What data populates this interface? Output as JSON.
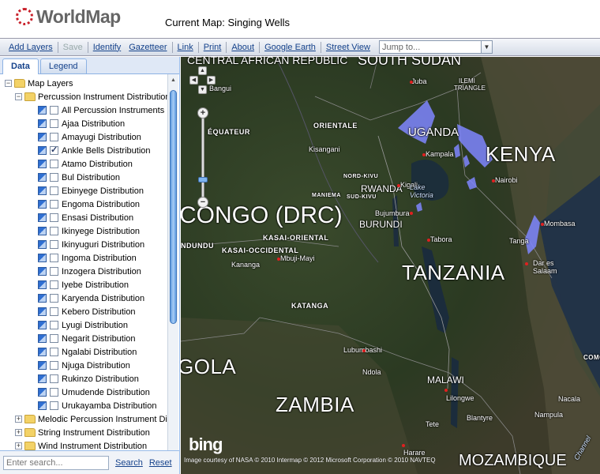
{
  "header": {
    "logo_text": "WorldMap",
    "current_map": "Current Map: Singing Wells"
  },
  "toolbar": {
    "buttons": [
      "Add Layers",
      "Save",
      "Identify",
      "Gazetteer",
      "Link",
      "Print",
      "About",
      "Google Earth",
      "Street View"
    ],
    "jump_placeholder": "Jump to..."
  },
  "panel": {
    "tabs": [
      "Data",
      "Legend"
    ],
    "root_folder": "Map Layers",
    "group_folder": "Percussion Instrument Distribution",
    "layers": [
      {
        "label": "All Percussion Instruments",
        "checked": false
      },
      {
        "label": "Ajaa Distribution",
        "checked": false
      },
      {
        "label": "Amayugi Distribution",
        "checked": false
      },
      {
        "label": "Ankle Bells Distribution",
        "checked": true
      },
      {
        "label": "Atamo Distribution",
        "checked": false
      },
      {
        "label": "Bul Distribution",
        "checked": false
      },
      {
        "label": "Ebinyege Distribution",
        "checked": false
      },
      {
        "label": "Engoma Distribution",
        "checked": false
      },
      {
        "label": "Ensasi Distribution",
        "checked": false
      },
      {
        "label": "Ikinyege Distribution",
        "checked": false
      },
      {
        "label": "Ikinyuguri Distribution",
        "checked": false
      },
      {
        "label": "Ingoma Distribution",
        "checked": false
      },
      {
        "label": "Inzogera Distribution",
        "checked": false
      },
      {
        "label": "Iyebe Distribution",
        "checked": false
      },
      {
        "label": "Karyenda Distribution",
        "checked": false
      },
      {
        "label": "Kebero Distribution",
        "checked": false
      },
      {
        "label": "Lyugi Distribution",
        "checked": false
      },
      {
        "label": "Negarit Distribution",
        "checked": false
      },
      {
        "label": "Ngalabi Distribution",
        "checked": false
      },
      {
        "label": "Njuga Distribution",
        "checked": false
      },
      {
        "label": "Rukinzo Distribution",
        "checked": false
      },
      {
        "label": "Umudende Distribution",
        "checked": false
      },
      {
        "label": "Urukayamba Distribution",
        "checked": false
      }
    ],
    "collapsed_folders": [
      "Melodic Percussion Instrument Distrib",
      "String Instrument Distribution",
      "Wind Instrument Distribution"
    ],
    "search_placeholder": "Enter search...",
    "search_label": "Search",
    "reset_label": "Reset"
  },
  "map": {
    "countries": [
      "CENTRAL AFRICAN REPUBLIC",
      "SOUTH SUDAN",
      "UGANDA",
      "KENYA",
      "RWANDA",
      "BURUNDI",
      "CONGO (DRC)",
      "TANZANIA",
      "GOLA",
      "ZAMBIA",
      "MALAWI",
      "MOZAMBIQUE"
    ],
    "regions": [
      "ORIENTALE",
      "ÉQUATEUR",
      "NORD-KIVU",
      "MANIEMA",
      "SUD-KIVU",
      "KASAI-ORIENTAL",
      "KASAI-OCCIDENTAL",
      "KATANGA",
      "NDUNDU",
      "COMO"
    ],
    "cities": [
      "Juba",
      "ILEMI",
      "TRIANGLE",
      "Bangui",
      "Kisangani",
      "Kampala",
      "Nairobi",
      "Kigali",
      "Bujumbura",
      "Mombasa",
      "Tabora",
      "Tanga",
      "Dar es Salaam",
      "Mbuji-Mayi",
      "Kananga",
      "Lubumbashi",
      "Ndola",
      "Lilongwe",
      "Blantyre",
      "Tete",
      "Nacala",
      "Nampula",
      "Harare"
    ],
    "lake_label": "Lake Victoria",
    "attribution": "Image courtesy of NASA © 2010 Intermap © 2012 Microsoft Corporation © 2010 NAVTEQ",
    "provider_logo": "bing",
    "water_label": "Channel",
    "highlight_color": "#7f86ff"
  }
}
